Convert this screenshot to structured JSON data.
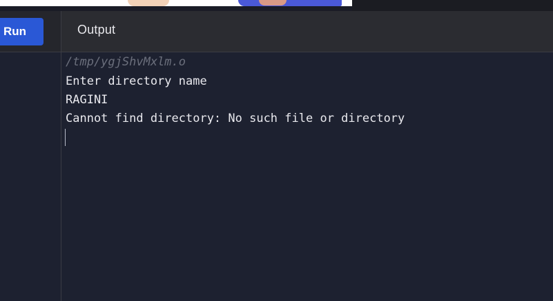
{
  "toolbar": {
    "run_label": "Run"
  },
  "output_panel": {
    "title": "Output",
    "lines": {
      "path": "/tmp/ygjShvMxlm.o",
      "prompt": "Enter directory name",
      "input": "RAGINI",
      "error": "Cannot find directory: No such file or directory"
    }
  },
  "colors": {
    "run_button": "#2a58d6",
    "background": "#1d2130",
    "header": "#2b2c31"
  }
}
